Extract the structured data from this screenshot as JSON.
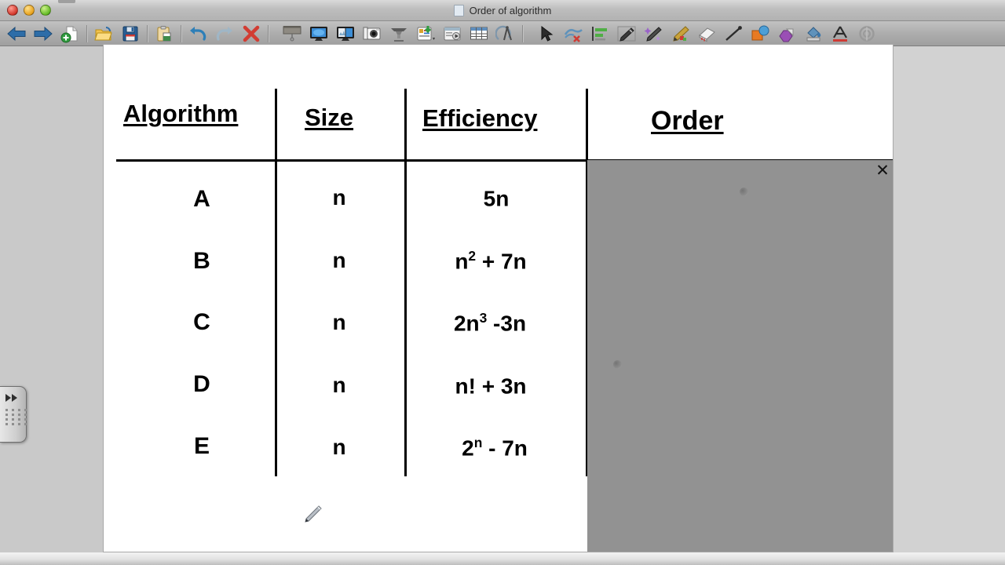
{
  "window": {
    "title": "Order of algorithm",
    "doc_icon": "document-icon",
    "buttons": [
      {
        "name": "close-window-button",
        "color": "#d2362a"
      },
      {
        "name": "minimize-window-button",
        "color": "#e8a21d"
      },
      {
        "name": "zoom-window-button",
        "color": "#63bb25"
      }
    ]
  },
  "toolbar": {
    "items": [
      {
        "name": "back-button",
        "icon": "arrow-left-icon",
        "label": "Back"
      },
      {
        "name": "forward-button",
        "icon": "arrow-right-icon",
        "label": "Forward"
      },
      {
        "name": "new-page-button",
        "icon": "new-page-icon",
        "label": "Add Page"
      },
      {
        "name": "open-button",
        "icon": "folder-open-icon",
        "label": "Open"
      },
      {
        "name": "save-button",
        "icon": "floppy-disk-icon",
        "label": "Save"
      },
      {
        "name": "paste-button",
        "icon": "clipboard-paste-icon",
        "label": "Paste"
      },
      {
        "name": "undo-button",
        "icon": "undo-arrow-icon",
        "label": "Undo"
      },
      {
        "name": "redo-button",
        "icon": "redo-arrow-icon",
        "label": "Redo"
      },
      {
        "name": "delete-button",
        "icon": "red-x-icon",
        "label": "Delete"
      },
      {
        "name": "screen-shade-button",
        "icon": "screen-shade-icon",
        "label": "Screen Shade"
      },
      {
        "name": "full-screen-button",
        "icon": "full-screen-icon",
        "label": "Full Screen"
      },
      {
        "name": "dual-page-button",
        "icon": "dual-page-icon",
        "label": "Dual Page Display"
      },
      {
        "name": "capture-button",
        "icon": "camera-icon",
        "label": "Screen Capture"
      },
      {
        "name": "spotlight-button",
        "icon": "spotlight-icon",
        "label": "Spotlight"
      },
      {
        "name": "insert-button",
        "icon": "insert-object-icon",
        "label": "Insert"
      },
      {
        "name": "record-button",
        "icon": "record-play-icon",
        "label": "Recorder"
      },
      {
        "name": "table-button",
        "icon": "table-grid-icon",
        "label": "Table"
      },
      {
        "name": "measure-button",
        "icon": "compass-protractor-icon",
        "label": "Measurement Tools"
      },
      {
        "name": "select-tool",
        "icon": "cursor-arrow-icon",
        "label": "Select"
      },
      {
        "name": "erase-ink-tool",
        "icon": "erase-ink-icon",
        "label": "Erase Ink"
      },
      {
        "name": "list-align-tool",
        "icon": "align-list-icon",
        "label": "Align"
      },
      {
        "name": "pen-tool",
        "icon": "pen-icon",
        "label": "Pens"
      },
      {
        "name": "magic-pen-tool",
        "icon": "magic-pen-icon",
        "label": "Magic Pen"
      },
      {
        "name": "crayon-tool",
        "icon": "crayon-icon",
        "label": "Creative Pen"
      },
      {
        "name": "eraser-tool",
        "icon": "eraser-icon",
        "label": "Eraser"
      },
      {
        "name": "line-tool",
        "icon": "line-icon",
        "label": "Lines"
      },
      {
        "name": "shapes-tool",
        "icon": "shapes-icon",
        "label": "Shapes"
      },
      {
        "name": "shape-fill-tool",
        "icon": "shape-fill-icon",
        "label": "Shape Fill"
      },
      {
        "name": "fill-tool",
        "icon": "paint-fill-icon",
        "label": "Fill"
      },
      {
        "name": "text-tool",
        "icon": "text-a-icon",
        "label": "Text"
      },
      {
        "name": "properties-tool",
        "icon": "properties-wheel-icon",
        "label": "Properties"
      }
    ]
  },
  "sidebar_handle": {
    "name": "sidebar-expand-handle",
    "icon": "double-chevron-right-icon"
  },
  "canvas": {
    "shade": {
      "label": "screen-shade-overlay",
      "color": "#929292",
      "close_label": "✕"
    },
    "cursor": "pen-cursor",
    "table": {
      "headers": [
        "Algorithm",
        "Size",
        "Efficiency",
        "Order"
      ],
      "rows": [
        {
          "algorithm": "A",
          "size": "n",
          "efficiency_base": "5n",
          "efficiency_sup": "",
          "efficiency_tail": "",
          "order": ""
        },
        {
          "algorithm": "B",
          "size": "n",
          "efficiency_base": "n",
          "efficiency_sup": "2",
          "efficiency_tail": " + 7n",
          "order": ""
        },
        {
          "algorithm": "C",
          "size": "n",
          "efficiency_base": "2n",
          "efficiency_sup": "3",
          "efficiency_tail": " -3n",
          "order": ""
        },
        {
          "algorithm": "D",
          "size": "n",
          "efficiency_base": "n! + 3n",
          "efficiency_sup": "",
          "efficiency_tail": "",
          "order": ""
        },
        {
          "algorithm": "E",
          "size": "n",
          "efficiency_base": "2",
          "efficiency_sup": "n",
          "efficiency_tail": " - 7n",
          "order": ""
        }
      ]
    }
  }
}
